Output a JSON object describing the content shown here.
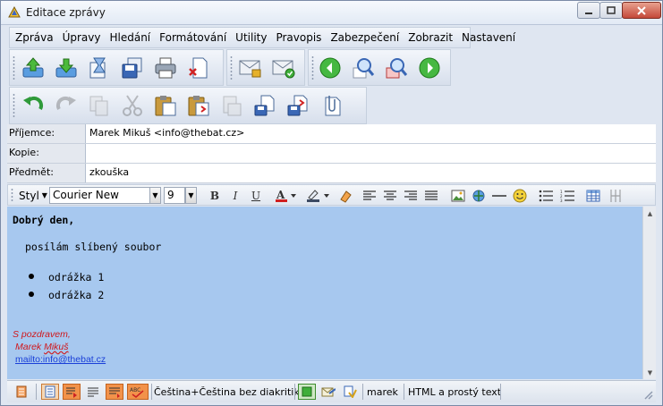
{
  "window": {
    "title": "Editace zprávy"
  },
  "menu": {
    "items": [
      "Zpráva",
      "Úpravy",
      "Hledání",
      "Formátování",
      "Utility",
      "Pravopis",
      "Zabezpečení",
      "Zobrazit",
      "Nastavení"
    ]
  },
  "toolbar": {
    "icons": [
      "send-now-icon",
      "queue-icon",
      "send-later-icon",
      "save-draft-icon",
      "print-icon",
      "discard-icon",
      "signature-lock-icon",
      "encrypt-icon",
      "back-icon",
      "find-icon",
      "find-replace-icon",
      "forward-icon",
      "undo-icon",
      "redo-icon",
      "copy-icon",
      "cut-icon",
      "paste-icon",
      "paste-quote-icon",
      "paste-disabled-icon",
      "save-attachment-icon",
      "insert-file-icon",
      "attach-icon"
    ]
  },
  "headers": {
    "to_label": "Příjemce:",
    "to_value": "Marek Mikuš <info@thebat.cz>",
    "cc_label": "Kopie:",
    "cc_value": "",
    "subject_label": "Předmět:",
    "subject_value": "zkouška"
  },
  "format": {
    "style_label": "Styl",
    "font": "Courier New",
    "size": "9",
    "bold": "B",
    "italic": "I",
    "underline": "U"
  },
  "body": {
    "greeting": "Dobrý den,",
    "line1": "posílám slíbený soubor",
    "bullets": [
      "odrážka 1",
      "odrážka 2"
    ],
    "sig_line1": "S pozdravem,",
    "sig_name_first": "Marek ",
    "sig_name_last": "Mikuš",
    "sig_link": "mailto:info@thebat.cz"
  },
  "status": {
    "spell": "Čeština+Čeština bez diakritiky",
    "user": "marek",
    "mode": "HTML a prostý text"
  },
  "colors": {
    "editor_bg": "#a7c8ef",
    "signature": "#d0161a",
    "link": "#1a3fd8"
  }
}
